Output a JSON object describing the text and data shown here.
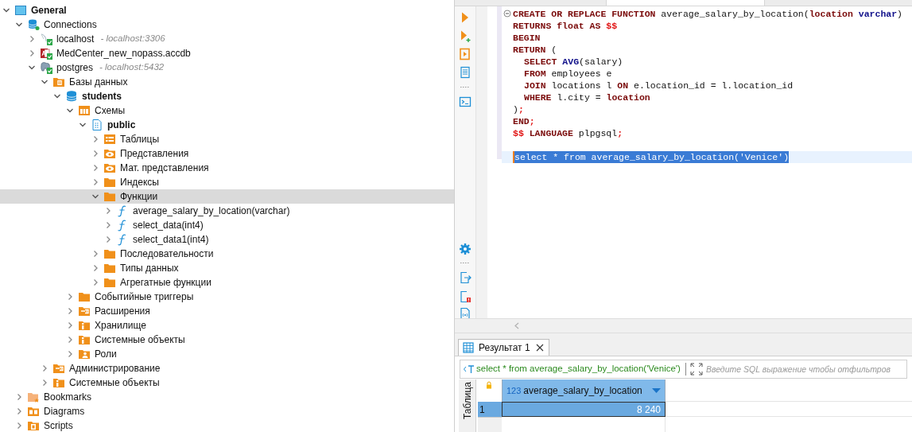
{
  "navigator": {
    "tree": [
      {
        "label": "General",
        "kind": "project",
        "expanded": true,
        "bold": true,
        "selected": false,
        "children": [
          {
            "label": "Connections",
            "kind": "connections",
            "expanded": true,
            "bold": false,
            "selected": false,
            "children": [
              {
                "label": "localhost",
                "detail": "- localhost:3306",
                "kind": "mysql",
                "expanded": false,
                "bold": false,
                "selected": false
              },
              {
                "label": "MedCenter_new_nopass.accdb",
                "kind": "access",
                "expanded": false,
                "bold": false,
                "selected": false
              },
              {
                "label": "postgres",
                "detail": "- localhost:5432",
                "kind": "postgres",
                "expanded": true,
                "bold": false,
                "selected": false,
                "children": [
                  {
                    "label": "Базы данных",
                    "kind": "databases",
                    "expanded": true,
                    "bold": false,
                    "selected": false,
                    "children": [
                      {
                        "label": "students",
                        "kind": "database",
                        "expanded": true,
                        "bold": true,
                        "selected": false,
                        "children": [
                          {
                            "label": "Схемы",
                            "kind": "schemas",
                            "expanded": true,
                            "bold": false,
                            "selected": false,
                            "children": [
                              {
                                "label": "public",
                                "kind": "schema",
                                "expanded": true,
                                "bold": true,
                                "selected": false,
                                "children": [
                                  {
                                    "label": "Таблицы",
                                    "kind": "tables",
                                    "expanded": false,
                                    "bold": false,
                                    "selected": false
                                  },
                                  {
                                    "label": "Представления",
                                    "kind": "views",
                                    "expanded": false,
                                    "bold": false,
                                    "selected": false
                                  },
                                  {
                                    "label": "Мат. представления",
                                    "kind": "views",
                                    "expanded": false,
                                    "bold": false,
                                    "selected": false
                                  },
                                  {
                                    "label": "Индексы",
                                    "kind": "folder",
                                    "expanded": false,
                                    "bold": false,
                                    "selected": false
                                  },
                                  {
                                    "label": "Функции",
                                    "kind": "folder",
                                    "expanded": true,
                                    "bold": false,
                                    "selected": true,
                                    "children": [
                                      {
                                        "label": "average_salary_by_location(varchar)",
                                        "kind": "function",
                                        "expanded": false,
                                        "bold": false,
                                        "selected": false
                                      },
                                      {
                                        "label": "select_data(int4)",
                                        "kind": "function",
                                        "expanded": false,
                                        "bold": false,
                                        "selected": false
                                      },
                                      {
                                        "label": "select_data1(int4)",
                                        "kind": "function",
                                        "expanded": false,
                                        "bold": false,
                                        "selected": false
                                      }
                                    ]
                                  },
                                  {
                                    "label": "Последовательности",
                                    "kind": "folder",
                                    "expanded": false,
                                    "bold": false,
                                    "selected": false
                                  },
                                  {
                                    "label": "Типы данных",
                                    "kind": "folder",
                                    "expanded": false,
                                    "bold": false,
                                    "selected": false
                                  },
                                  {
                                    "label": "Агрегатные функции",
                                    "kind": "folder",
                                    "expanded": false,
                                    "bold": false,
                                    "selected": false
                                  }
                                ]
                              }
                            ]
                          },
                          {
                            "label": "Событийные триггеры",
                            "kind": "folder",
                            "expanded": false,
                            "bold": false,
                            "selected": false
                          },
                          {
                            "label": "Расширения",
                            "kind": "extensions",
                            "expanded": false,
                            "bold": false,
                            "selected": false
                          },
                          {
                            "label": "Хранилище",
                            "kind": "info",
                            "expanded": false,
                            "bold": false,
                            "selected": false
                          },
                          {
                            "label": "Системные объекты",
                            "kind": "info",
                            "expanded": false,
                            "bold": false,
                            "selected": false
                          },
                          {
                            "label": "Роли",
                            "kind": "roles",
                            "expanded": false,
                            "bold": false,
                            "selected": false
                          }
                        ]
                      }
                    ]
                  },
                  {
                    "label": "Администрирование",
                    "kind": "extensions",
                    "expanded": false,
                    "bold": false,
                    "selected": false
                  },
                  {
                    "label": "Системные объекты",
                    "kind": "info",
                    "expanded": false,
                    "bold": false,
                    "selected": false
                  }
                ]
              }
            ]
          },
          {
            "label": "Bookmarks",
            "kind": "bookmarks",
            "expanded": false,
            "bold": false,
            "selected": false
          },
          {
            "label": "Diagrams",
            "kind": "diagrams",
            "expanded": false,
            "bold": false,
            "selected": false
          },
          {
            "label": "Scripts",
            "kind": "scripts",
            "expanded": false,
            "bold": false,
            "selected": false
          }
        ]
      }
    ]
  },
  "editor": {
    "lines": [
      {
        "selected": false,
        "tokens": [
          {
            "kind": "keyword",
            "text": "CREATE OR REPLACE FUNCTION"
          },
          {
            "kind": "plain",
            "text": " average_salary_by_location("
          },
          {
            "kind": "keyword",
            "text": "location"
          },
          {
            "kind": "builtin",
            "text": " varchar"
          },
          {
            "kind": "plain",
            "text": ")"
          }
        ]
      },
      {
        "selected": false,
        "tokens": [
          {
            "kind": "keyword",
            "text": "RETURNS float AS"
          },
          {
            "kind": "delimiter",
            "text": " $$"
          }
        ]
      },
      {
        "selected": false,
        "tokens": [
          {
            "kind": "keyword",
            "text": "BEGIN"
          }
        ]
      },
      {
        "selected": false,
        "tokens": [
          {
            "kind": "keyword",
            "text": "RETURN"
          },
          {
            "kind": "plain",
            "text": " ("
          }
        ]
      },
      {
        "selected": false,
        "indented": true,
        "tokens": [
          {
            "kind": "keyword",
            "text": "SELECT"
          },
          {
            "kind": "builtin",
            "text": " AVG"
          },
          {
            "kind": "plain",
            "text": "(salary)"
          }
        ]
      },
      {
        "selected": false,
        "indented": true,
        "tokens": [
          {
            "kind": "keyword",
            "text": "FROM"
          },
          {
            "kind": "plain",
            "text": " employees e"
          }
        ]
      },
      {
        "selected": false,
        "indented": true,
        "tokens": [
          {
            "kind": "keyword",
            "text": "JOIN"
          },
          {
            "kind": "plain",
            "text": " locations l "
          },
          {
            "kind": "keyword",
            "text": "ON"
          },
          {
            "kind": "plain",
            "text": " e.location_id = l.location_id"
          }
        ]
      },
      {
        "selected": false,
        "indented": true,
        "tokens": [
          {
            "kind": "keyword",
            "text": "WHERE"
          },
          {
            "kind": "plain",
            "text": " l.city = "
          },
          {
            "kind": "keyword",
            "text": "location"
          }
        ]
      },
      {
        "selected": false,
        "tokens": [
          {
            "kind": "plain",
            "text": ")"
          },
          {
            "kind": "delimiter",
            "text": ";"
          }
        ]
      },
      {
        "selected": false,
        "tokens": [
          {
            "kind": "keyword",
            "text": "END"
          },
          {
            "kind": "delimiter",
            "text": ";"
          }
        ]
      },
      {
        "selected": false,
        "tokens": [
          {
            "kind": "delimiter",
            "text": "$$"
          },
          {
            "kind": "keyword",
            "text": " LANGUAGE"
          },
          {
            "kind": "plain",
            "text": " plpgsql"
          },
          {
            "kind": "delimiter",
            "text": ";"
          }
        ]
      },
      {
        "selected": true,
        "blank_line_before": true,
        "tokens": [
          {
            "kind": "plain",
            "text": "select * from average_salary_by_location('Venice')"
          }
        ]
      }
    ]
  },
  "results": {
    "tabs": [
      {
        "label": "Результат 1",
        "selected": true
      }
    ],
    "query": "select * from average_salary_by_location('Venice')",
    "filter": {
      "placeholder": "Введите SQL выражение чтобы отфильтров"
    },
    "side_tab": "Таблица",
    "columns": [
      {
        "type": "123",
        "name": "average_salary_by_location"
      }
    ],
    "rows": [
      {
        "number": "1",
        "selected": true,
        "cells": [
          "8 240"
        ]
      }
    ]
  }
}
